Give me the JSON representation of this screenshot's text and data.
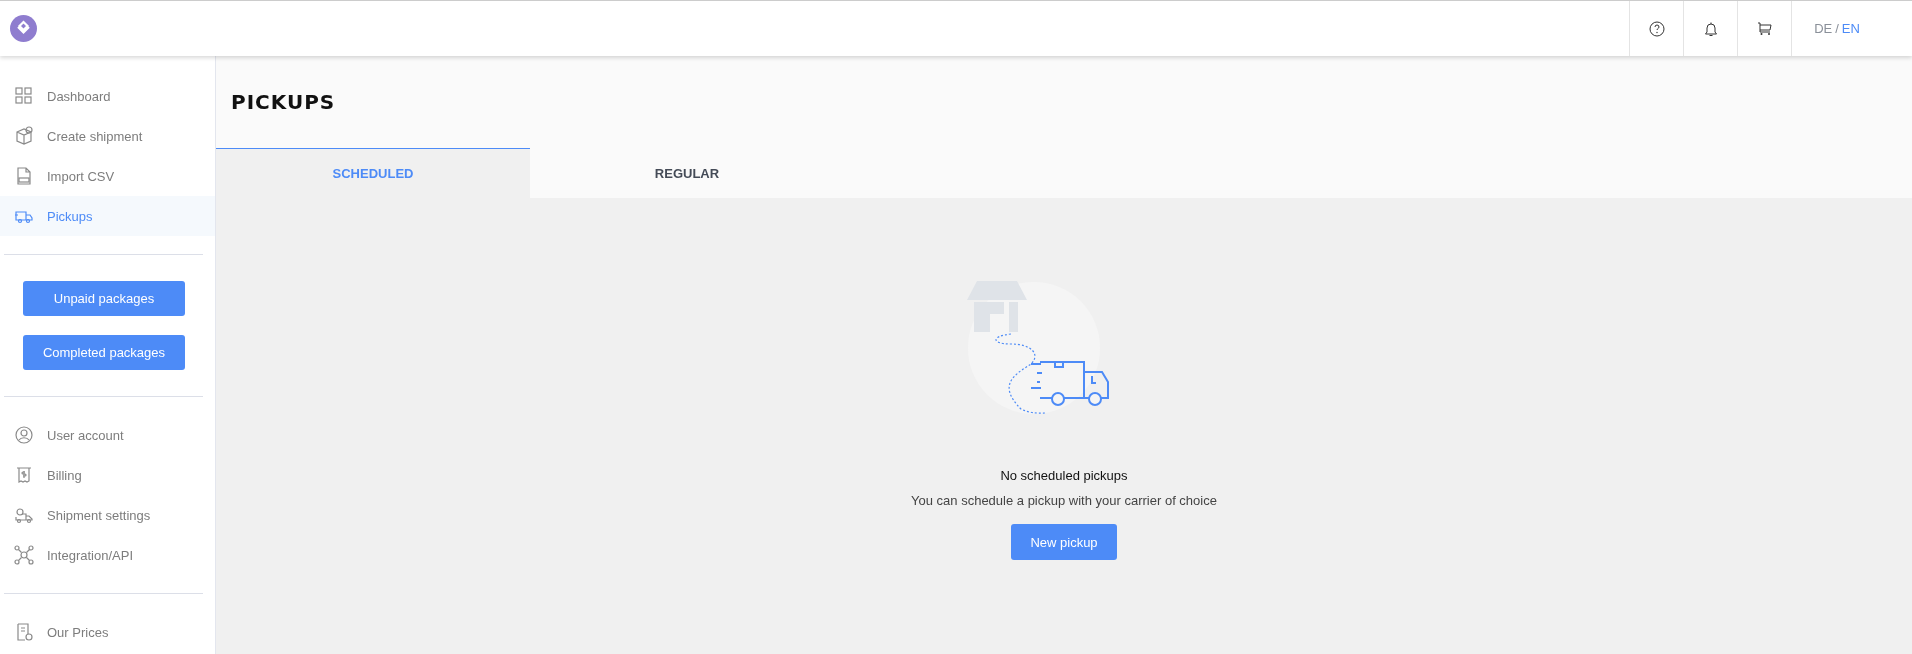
{
  "header": {
    "languages": [
      {
        "label": "DE",
        "selected": false
      },
      {
        "label": "EN",
        "selected": true
      }
    ],
    "language_separator": "/"
  },
  "sidebar": {
    "nav": [
      {
        "label": "Dashboard",
        "kind": "grid",
        "selected": false
      },
      {
        "label": "Create shipment",
        "kind": "box",
        "selected": false
      },
      {
        "label": "Import CSV",
        "kind": "csv",
        "selected": false
      },
      {
        "label": "Pickups",
        "kind": "truck",
        "selected": true
      }
    ],
    "buttons": [
      "Unpaid packages",
      "Completed packages"
    ],
    "account": [
      {
        "label": "User account",
        "kind": "user"
      },
      {
        "label": "Billing",
        "kind": "bill"
      },
      {
        "label": "Shipment settings",
        "kind": "settings"
      },
      {
        "label": "Integration/API",
        "kind": "api"
      }
    ],
    "extra": [
      {
        "label": "Our Prices",
        "kind": "prices"
      }
    ]
  },
  "page": {
    "title": "PICKUPS",
    "tabs": [
      {
        "label": "SCHEDULED",
        "selected": true
      },
      {
        "label": "REGULAR",
        "selected": false
      }
    ],
    "empty": {
      "title": "No scheduled pickups",
      "text": "You can schedule a pickup with your carrier of choice",
      "button": "New pickup"
    }
  }
}
